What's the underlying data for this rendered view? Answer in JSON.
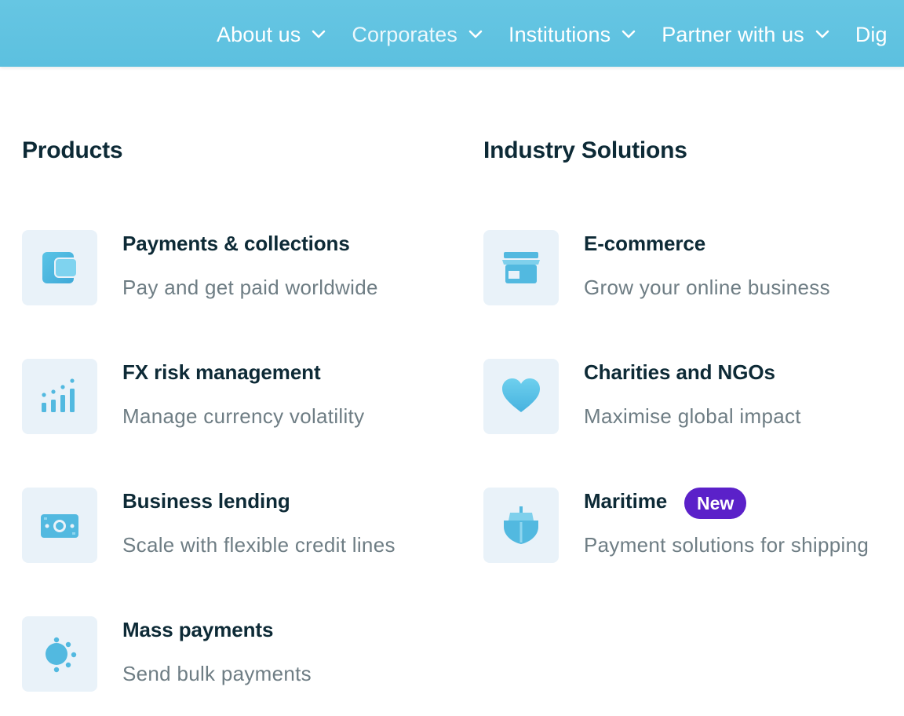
{
  "nav": {
    "items": [
      {
        "label": "About us"
      },
      {
        "label": "Corporates"
      },
      {
        "label": "Institutions"
      },
      {
        "label": "Partner with us"
      },
      {
        "label": "Dig"
      }
    ]
  },
  "products": {
    "title": "Products",
    "items": [
      {
        "title": "Payments & collections",
        "description": "Pay and get paid worldwide",
        "icon": "wallet-icon"
      },
      {
        "title": "FX risk management",
        "description": "Manage currency volatility",
        "icon": "bar-chart-icon"
      },
      {
        "title": "Business lending",
        "description": "Scale with flexible credit lines",
        "icon": "banknote-icon"
      },
      {
        "title": "Mass payments",
        "description": "Send bulk payments",
        "icon": "burst-icon"
      }
    ]
  },
  "industry": {
    "title": "Industry Solutions",
    "items": [
      {
        "title": "E-commerce",
        "description": "Grow your online business",
        "icon": "storefront-icon"
      },
      {
        "title": "Charities and NGOs",
        "description": "Maximise global impact",
        "icon": "heart-icon"
      },
      {
        "title": "Maritime",
        "description": "Payment solutions for shipping",
        "icon": "ship-icon",
        "badge": "New"
      }
    ]
  },
  "colors": {
    "header_bg": "#5cc0df",
    "heading_text": "#0d2a36",
    "muted_text": "#6e7d84",
    "icon_tile_bg": "#e9f2f9",
    "icon_blue": "#52b9e0",
    "badge_bg": "#5b21c9"
  }
}
